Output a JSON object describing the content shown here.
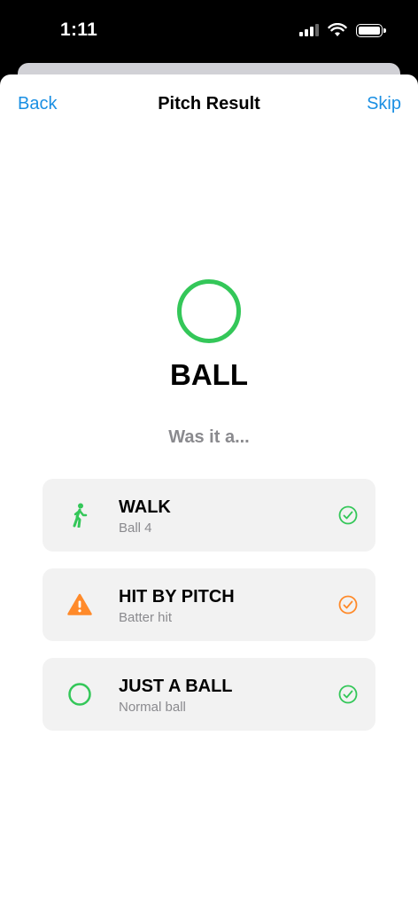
{
  "status_bar": {
    "time": "1:11"
  },
  "nav": {
    "back_label": "Back",
    "title": "Pitch Result",
    "skip_label": "Skip"
  },
  "result": {
    "title": "BALL",
    "icon": "circle-outline-icon",
    "color": "#34c759"
  },
  "question": "Was it a...",
  "options": [
    {
      "title": "WALK",
      "subtitle": "Ball 4",
      "icon": "walking-person-icon",
      "color": "#34c759"
    },
    {
      "title": "HIT BY PITCH",
      "subtitle": "Batter hit",
      "icon": "warning-triangle-icon",
      "color": "#ff8a2a"
    },
    {
      "title": "JUST A BALL",
      "subtitle": "Normal ball",
      "icon": "circle-outline-icon",
      "color": "#34c759"
    }
  ],
  "colors": {
    "accent": "#1a8fe3",
    "green": "#34c759",
    "orange": "#ff8a2a",
    "card_bg": "#f2f2f2"
  }
}
